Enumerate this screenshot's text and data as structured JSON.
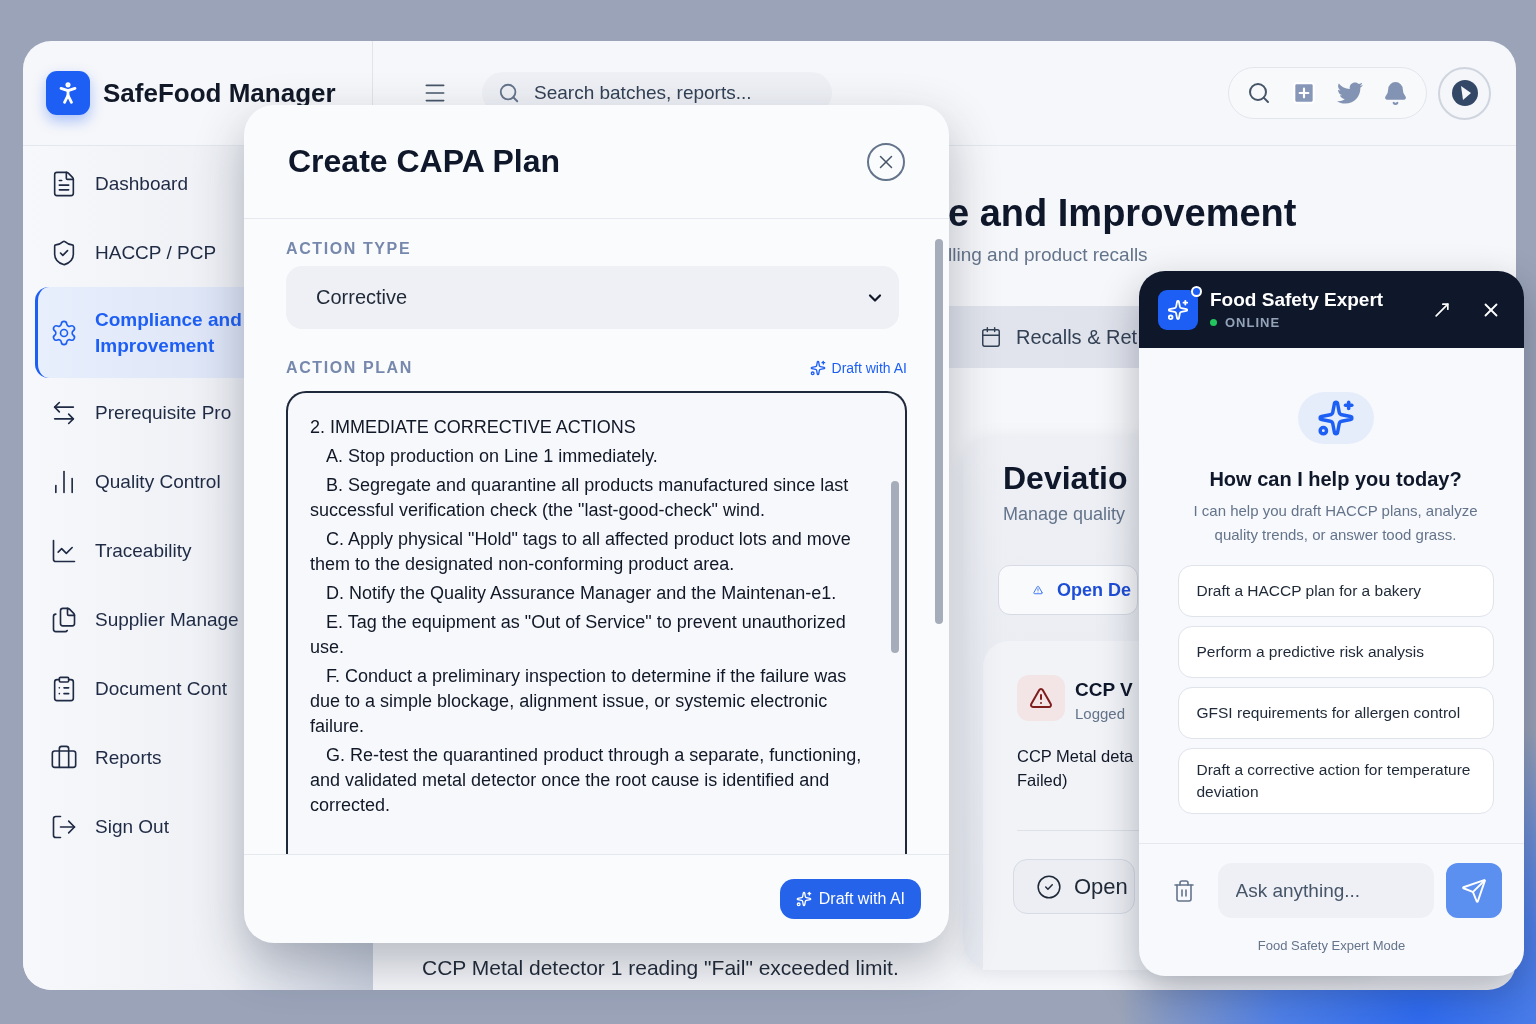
{
  "app": {
    "name": "SafeFood Manager"
  },
  "search": {
    "placeholder": "Search batches, reports..."
  },
  "sidebar": {
    "items": [
      {
        "label": "Dashboard",
        "selected": false
      },
      {
        "label": "HACCP / PCP",
        "selected": false
      },
      {
        "label": "Compliance and Improvement",
        "selected": true
      },
      {
        "label": "Prerequisite Pro",
        "selected": false
      },
      {
        "label": "Quality Control",
        "selected": false
      },
      {
        "label": "Traceability",
        "selected": false
      },
      {
        "label": "Supplier Manage",
        "selected": false
      },
      {
        "label": "Document Cont",
        "selected": false
      },
      {
        "label": "Reports",
        "selected": false
      },
      {
        "label": "Sign Out",
        "selected": false
      }
    ]
  },
  "page": {
    "title": "e and Improvement",
    "subtitle": "lling and product recalls",
    "tabs": [
      {
        "label": "Recalls & Ret",
        "selected": false
      }
    ],
    "deviations": {
      "title": "Deviatio",
      "subtitle": "Manage quality",
      "open_button": "Open De",
      "record": {
        "title": "CCP V",
        "meta": "Logged",
        "description": [
          "CCP Metal deta",
          "Failed)"
        ],
        "action": "Open"
      }
    },
    "alert_text": "CCP Metal detector 1 reading \"Fail\" exceeded limit."
  },
  "modal": {
    "title": "Create CAPA Plan",
    "action_type": {
      "label": "ACTION TYPE",
      "value": "Corrective"
    },
    "action_plan": {
      "label": "ACTION PLAN",
      "draft_link": "Draft with AI",
      "lines": [
        {
          "kind": "heading",
          "text": "2. IMMEDIATE CORRECTIVE ACTIONS"
        },
        {
          "kind": "item",
          "text": "A. Stop production on Line 1 immediately."
        },
        {
          "kind": "item",
          "text": "B. Segregate and quarantine all products manufactured since last successful verification check (the \"last-good-check\" wind."
        },
        {
          "kind": "item",
          "text": "C. Apply physical \"Hold\" tags to all affected product lots and move them to the designated non-conforming product area."
        },
        {
          "kind": "item",
          "text": "D. Notify the Quality Assurance Manager and the Maintenan-e1."
        },
        {
          "kind": "item",
          "text": "E. Tag the equipment as \"Out of Service\" to prevent unauthorized use."
        },
        {
          "kind": "item",
          "text": "F. Conduct a preliminary inspection to determine if the failure was due to a simple blockage, alignment issue, or systemic electronic failure."
        },
        {
          "kind": "item",
          "text": "G. Re-test the quarantined product through a separate, functioning, and validated metal detector once the root cause is identified and corrected."
        }
      ]
    },
    "footer_button": "Draft with AI"
  },
  "chat": {
    "title": "Food Safety Expert",
    "status": {
      "label": "ONLINE",
      "online": true
    },
    "heading": "How can I help you today?",
    "intro": "I can help you draft HACCP plans, analyze quality trends, or answer tood grass.",
    "suggestions": [
      "Draft a HACCP plan for a bakery",
      "Perform a predictive risk analysis",
      "GFSI requirements for allergen control",
      "Draft a corrective action for temperature deviation"
    ],
    "input": {
      "placeholder": "Ask anything..."
    },
    "mode_note": "Food Safety Expert Mode"
  }
}
